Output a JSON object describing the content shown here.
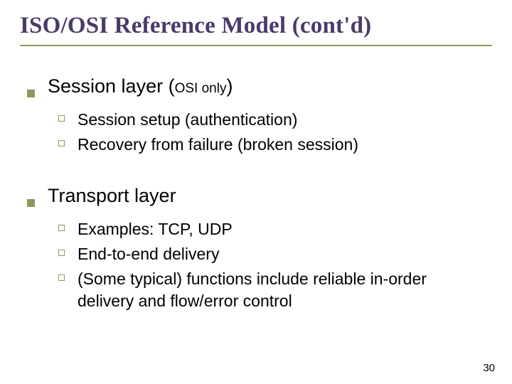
{
  "title": "ISO/OSI Reference Model (cont'd)",
  "sections": [
    {
      "heading_pre": "Session layer (",
      "heading_sub": "OSI only",
      "heading_post": ")",
      "items": [
        "Session setup (authentication)",
        "Recovery from failure (broken session)"
      ]
    },
    {
      "heading_pre": "Transport layer",
      "heading_sub": "",
      "heading_post": "",
      "items": [
        "Examples: TCP, UDP",
        "End-to-end delivery",
        "(Some typical) functions include reliable in-order delivery and flow/error control"
      ]
    }
  ],
  "page_number": "30"
}
